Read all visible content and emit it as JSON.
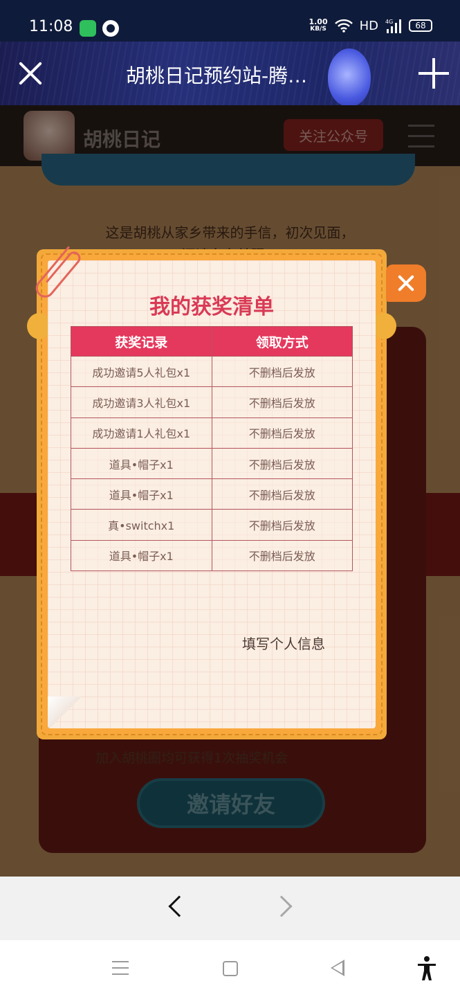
{
  "status_bar": {
    "time": "11:08",
    "net_speed_value": "1.00",
    "net_speed_unit": "KB/S",
    "hd": "HD",
    "network": "4G",
    "battery": "68"
  },
  "browser": {
    "title": "胡桃日记预约站-腾…"
  },
  "site": {
    "name": "胡桃日记",
    "follow_button": "关注公众号",
    "intro_line1": "这是胡桃从家乡带来的手信，初次见面，",
    "intro_line2": "还请多多关照！",
    "join_text": "加入胡桃圈均可获得1次抽奖机会",
    "invite_button": "邀请好友"
  },
  "modal": {
    "title": "我的获奖清单",
    "columns": [
      "获奖记录",
      "领取方式"
    ],
    "rows": [
      [
        "成功邀请5人礼包x1",
        "不删档后发放"
      ],
      [
        "成功邀请3人礼包x1",
        "不删档后发放"
      ],
      [
        "成功邀请1人礼包x1",
        "不删档后发放"
      ],
      [
        "道具•帽子x1",
        "不删档后发放"
      ],
      [
        "道具•帽子x1",
        "不删档后发放"
      ],
      [
        "真•switchx1",
        "不删档后发放"
      ],
      [
        "道具•帽子x1",
        "不删档后发放"
      ]
    ],
    "fill_info": "填写个人信息"
  },
  "colors": {
    "modal_frame": "#f3a93a",
    "table_header": "#e5385d",
    "title": "#d93a55",
    "close_button": "#f07d2a"
  }
}
